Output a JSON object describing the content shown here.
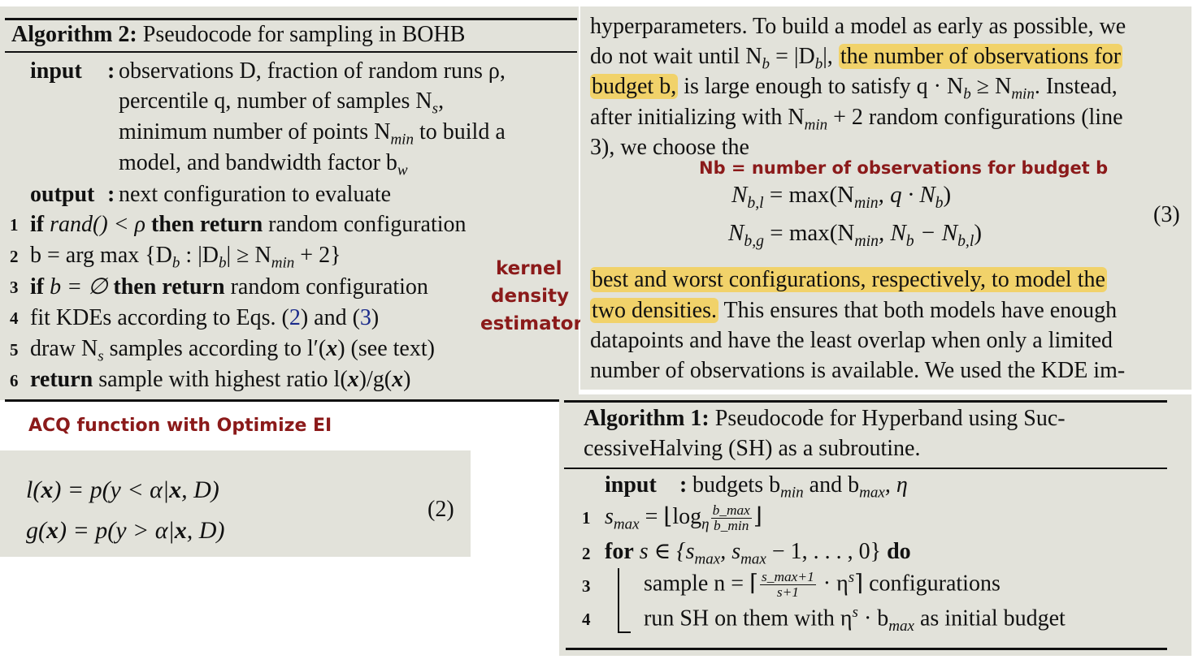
{
  "alg2": {
    "title_bold": "Algorithm 2:",
    "title_rest": " Pseudocode for sampling in BOHB",
    "input_kw": "input",
    "input_colon": ":",
    "input_l1": "observations D, fraction of random runs ρ,",
    "input_l2": "percentile q, number of samples N",
    "input_l2_sub": "s",
    "input_l2_end": ",",
    "input_l3a": "minimum number of points N",
    "input_l3_sub": "min",
    "input_l3b": " to build a",
    "input_l4": "model, and bandwidth factor b",
    "input_l4_sub": "w",
    "output_kw": "output",
    "output_colon": ":",
    "output_text": "next configuration to evaluate",
    "lines": [
      {
        "num": "1",
        "a": "if",
        "b": " rand() < ρ ",
        "c": "then return",
        "d": " random configuration"
      },
      {
        "num": "2",
        "a": "b = arg max {D",
        "sub1": "b",
        "b": " : |D",
        "sub2": "b",
        "c": "| ≥ N",
        "sub3": "min",
        "d": " + 2}"
      },
      {
        "num": "3",
        "a": "if",
        "b": " b = ∅ ",
        "c": "then  return",
        "d": " random configuration"
      },
      {
        "num": "4",
        "a": "fit KDEs according to Eqs. (",
        "r1": "2",
        "b": ") and  (",
        "r2": "3",
        "c": ")"
      },
      {
        "num": "5",
        "a": "draw N",
        "sub1": "s",
        "b": " samples according to l′(",
        "x": "x",
        "c": ") (see text)"
      },
      {
        "num": "6",
        "a": "return",
        "b": " sample with highest ratio l(",
        "x1": "x",
        "c": ")/g(",
        "x2": "x",
        "d": ")"
      }
    ]
  },
  "notes": {
    "kernel": "kernel",
    "density": "density",
    "estimator": "estimator",
    "acq": "ACQ function with Optimize EI",
    "nb": "Nb = number of observations for budget b"
  },
  "eq2": {
    "l1_a": "l(",
    "l1_x": "x",
    "l1_b": ") = p(y < α|",
    "l1_x2": "x",
    "l1_c": ", D)",
    "l2_a": "g(",
    "l2_x": "x",
    "l2_b": ") = p(y > α|",
    "l2_x2": "x",
    "l2_c": ", D)",
    "num": "(2)"
  },
  "text": {
    "p1_l1": "hyperparameters. To build a model as early as possible, we",
    "p1_l2a": "do not wait until N",
    "p1_l2sub": "b",
    "p1_l2b": " = |D",
    "p1_l2sub2": "b",
    "p1_l2c": "|, ",
    "p1_l2hl": "the number of observations for",
    "p1_l3hl": "budget b,",
    "p1_l3a": " is large enough to satisfy q · N",
    "p1_l3sub": "b",
    "p1_l3b": " ≥ N",
    "p1_l3sub2": "min",
    "p1_l3c": ". Instead,",
    "p1_l4a": "after initializing with N",
    "p1_l4sub": "min",
    "p1_l4b": " + 2 random configurations (line",
    "p1_l5": "3), we choose the",
    "eq3_l1a": "N",
    "eq3_l1sub": "b,l",
    "eq3_l1b": " = max(N",
    "eq3_l1sub2": "min",
    "eq3_l1c": ", q · N",
    "eq3_l1sub3": "b",
    "eq3_l1d": ")",
    "eq3_l2a": "N",
    "eq3_l2sub": "b,g",
    "eq3_l2b": " = max(N",
    "eq3_l2sub2": "min",
    "eq3_l2c": ", N",
    "eq3_l2sub3": "b",
    "eq3_l2d": " − N",
    "eq3_l2sub4": "b,l",
    "eq3_l2e": ")",
    "eq3_num": "(3)",
    "p2_l1hl": "best and worst configurations, respectively, to model the",
    "p2_l2hl": "two densities.",
    "p2_l2": " This ensures that both models have enough",
    "p2_l3": "datapoints and have the least overlap when only a limited",
    "p2_l4": "number of observations is available. We used the KDE im-"
  },
  "alg1": {
    "title_bold": "Algorithm 1:",
    "title_rest": " Pseudocode for Hyperband using Suc-",
    "title_l2": "cessiveHalving (SH) as a subroutine.",
    "input_kw": "input",
    "input_colon": ":",
    "input_a": "budgets b",
    "input_sub1": "min",
    "input_b": " and b",
    "input_sub2": "max",
    "input_c": ", η",
    "l1_num": "1",
    "l1_a": "s",
    "l1_sub": "max",
    "l1_b": " = ⌊log",
    "l1_sub2": "η",
    "l1_num_top": "b_max",
    "l1_num_bot": "b_min",
    "l1_c": "⌋",
    "l2_num": "2",
    "l2_kw": "for",
    "l2_a": " s ∈ {s",
    "l2_sub": "max",
    "l2_b": ", s",
    "l2_sub2": "max",
    "l2_c": " − 1, . . . , 0} ",
    "l2_kw2": "do",
    "l3_num": "3",
    "l3_a": "sample n = ⌈",
    "l3_top": "s_max+1",
    "l3_bot": "s+1",
    "l3_b": " · η",
    "l3_sup": "s",
    "l3_c": "⌉ configurations",
    "l4_num": "4",
    "l4_a": "run SH on them with η",
    "l4_sup": "s",
    "l4_b": " · b",
    "l4_sub": "max",
    "l4_c": " as initial budget"
  }
}
